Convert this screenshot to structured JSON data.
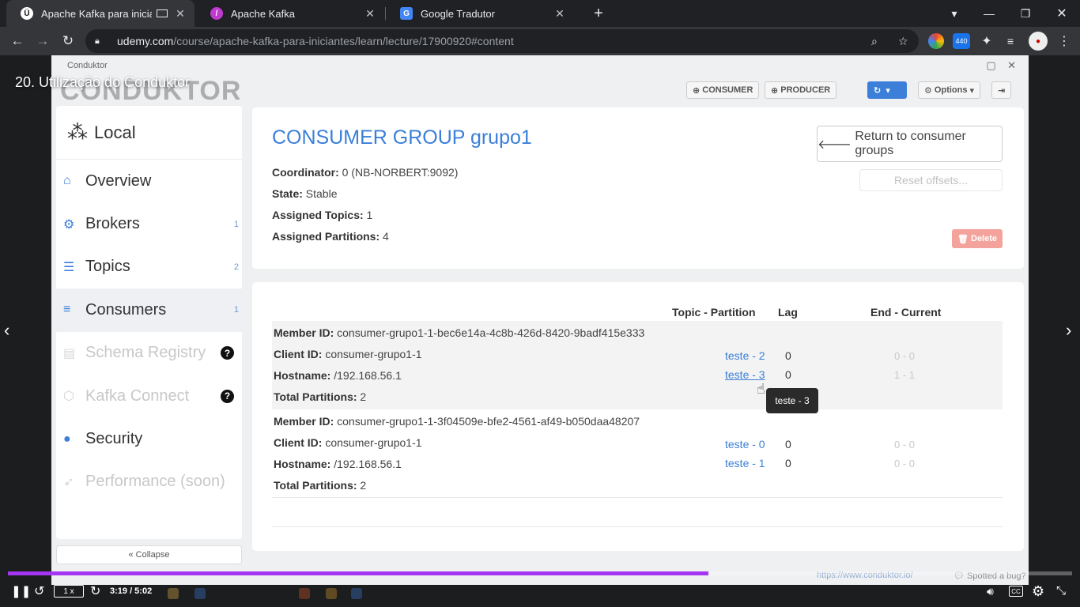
{
  "browser": {
    "tabs": [
      {
        "title": "Apache Kafka para iniciantes",
        "favicon": "Ü"
      },
      {
        "title": "Apache Kafka",
        "favicon": "/"
      },
      {
        "title": "Google Tradutor",
        "favicon": "G"
      }
    ],
    "url_host": "udemy.com",
    "url_path": "/course/apache-kafka-para-iniciantes/learn/lecture/17900920#content",
    "ext_badge": "440",
    "new_tab": "+"
  },
  "video": {
    "title": "20. Utilização do Conduktor",
    "progress_fraction": 0.658,
    "speed": "1 x",
    "time": "3:19 / 5:02",
    "cc": "CC"
  },
  "app": {
    "window_title": "Conduktor",
    "logo": "CONDUKTOR",
    "header_buttons": {
      "consumer": "CONSUMER",
      "producer": "PRODUCER",
      "options": "Options"
    },
    "sidebar": {
      "cluster": "Local",
      "items": [
        {
          "label": "Overview",
          "icon": "home-icon",
          "badge": ""
        },
        {
          "label": "Brokers",
          "icon": "gears-icon",
          "badge": "1"
        },
        {
          "label": "Topics",
          "icon": "server-icon",
          "badge": "2"
        },
        {
          "label": "Consumers",
          "icon": "sliders-icon",
          "badge": "1"
        },
        {
          "label": "Schema Registry",
          "icon": "document-icon",
          "badge": ""
        },
        {
          "label": "Kafka Connect",
          "icon": "hexagon-icon",
          "badge": ""
        },
        {
          "label": "Security",
          "icon": "lock-icon",
          "badge": ""
        },
        {
          "label": "Performance (soon)",
          "icon": "rocket-icon",
          "badge": ""
        }
      ],
      "help": "?",
      "collapse": "« Collapse"
    },
    "group": {
      "title": "CONSUMER GROUP grupo1",
      "coordinator_label": "Coordinator:",
      "coordinator": "0 (NB-NORBERT:9092)",
      "state_label": "State:",
      "state": "Stable",
      "topics_label": "Assigned Topics:",
      "topics": "1",
      "partitions_label": "Assigned Partitions:",
      "partitions": "4",
      "return_btn": "Return to consumer groups",
      "reset_btn": "Reset offsets...",
      "delete_btn": "Delete"
    },
    "table": {
      "headers": {
        "topic_partition": "Topic - Partition",
        "lag": "Lag",
        "end_current": "End - Current"
      },
      "labels": {
        "member": "Member ID:",
        "client": "Client ID:",
        "host": "Hostname:",
        "total": "Total Partitions:"
      },
      "members": [
        {
          "member_id": "consumer-grupo1-1-bec6e14a-4c8b-426d-8420-9badf415e333",
          "client_id": "consumer-grupo1-1",
          "hostname": "/192.168.56.1",
          "total": "2",
          "partitions": [
            {
              "topic": "teste - 2",
              "lag": "0",
              "end_current": "0 - 0"
            },
            {
              "topic": "teste - 3",
              "lag": "0",
              "end_current": "1 - 1"
            }
          ]
        },
        {
          "member_id": "consumer-grupo1-1-3f04509e-bfe2-4561-af49-b050daa48207",
          "client_id": "consumer-grupo1-1",
          "hostname": "/192.168.56.1",
          "total": "2",
          "partitions": [
            {
              "topic": "teste - 0",
              "lag": "0",
              "end_current": "0 - 0"
            },
            {
              "topic": "teste - 1",
              "lag": "0",
              "end_current": "0 - 0"
            }
          ]
        }
      ],
      "tooltip": "teste - 3"
    },
    "footer": {
      "link": "https://www.conduktor.io/",
      "bug": "Spotted a bug?"
    }
  }
}
